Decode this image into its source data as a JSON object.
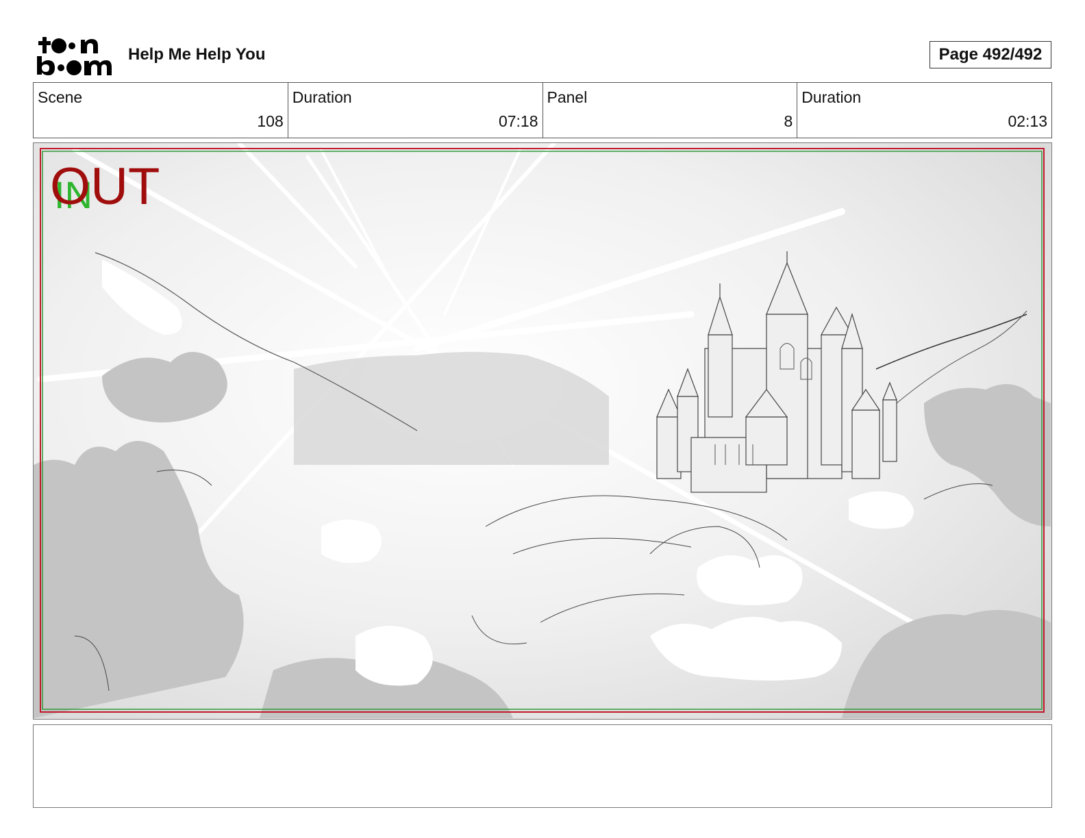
{
  "header": {
    "logo_top": "to•n",
    "logo_bottom": "b••m",
    "title": "Help Me Help You",
    "page_label": "Page 492/492"
  },
  "info": {
    "scene_label": "Scene",
    "scene_value": "108",
    "scene_duration_label": "Duration",
    "scene_duration_value": "07:18",
    "panel_label": "Panel",
    "panel_value": "8",
    "panel_duration_label": "Duration",
    "panel_duration_value": "02:13"
  },
  "panel": {
    "in_label": "IN",
    "out_label": "OUT",
    "safe_frame_color": "#c0182a",
    "action_frame_color": "#2e9a3a"
  },
  "notes": {
    "text": ""
  }
}
